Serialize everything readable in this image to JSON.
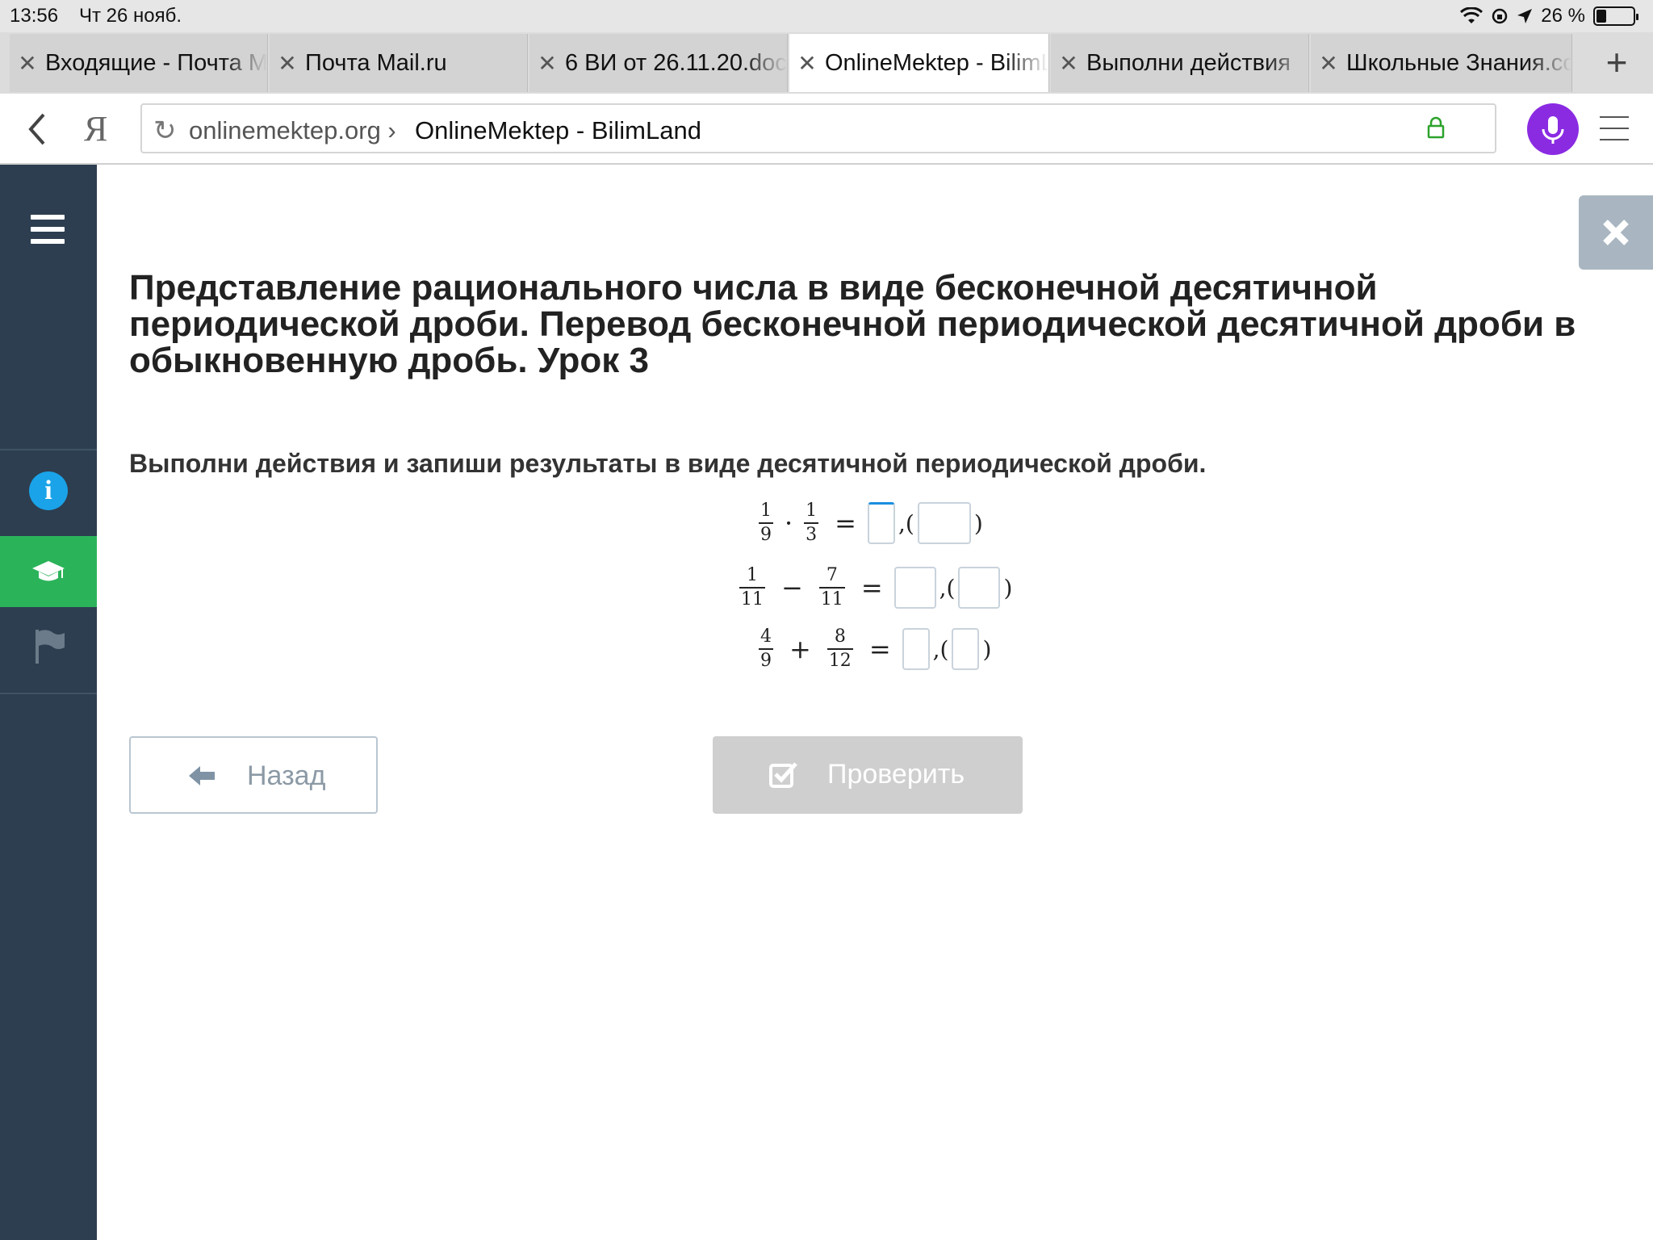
{
  "status_bar": {
    "time": "13:56",
    "date": "Чт 26 нояб.",
    "battery_text": "26 %",
    "battery_level": 0.26
  },
  "tabs": [
    {
      "label": "Входящие - Почта Mail.ru"
    },
    {
      "label": "Почта Mail.ru"
    },
    {
      "label": "6 ВИ от 26.11.20.docx"
    },
    {
      "label": "OnlineMektep - BilimLand"
    },
    {
      "label": "Выполни действия"
    },
    {
      "label": "Школьные Знания.com"
    }
  ],
  "address_bar": {
    "yandex_letter": "Я",
    "domain": "onlinemektep.org ›",
    "page_title": "OnlineMektep - BilimLand"
  },
  "lesson": {
    "title": "Представление рационального числа в виде бесконечной десятичной периодической дроби. Перевод бесконечной периодической десятичной дроби в обыкновенную дробь. Урок 3",
    "task": "Выполни действия и запиши результаты в виде десятичной периодической дроби."
  },
  "equations": [
    {
      "a_num": "1",
      "a_den": "9",
      "op": "·",
      "b_num": "1",
      "b_den": "3",
      "eq": "=",
      "comma": ",(",
      "close": ")"
    },
    {
      "a_num": "1",
      "a_den": "11",
      "op": "−",
      "b_num": "7",
      "b_den": "11",
      "eq": "=",
      "comma": ",(",
      "close": ")"
    },
    {
      "a_num": "4",
      "a_den": "9",
      "op": "+",
      "b_num": "8",
      "b_den": "12",
      "eq": "=",
      "comma": ",(",
      "close": ")"
    }
  ],
  "buttons": {
    "back": "Назад",
    "check": "Проверить"
  },
  "colors": {
    "sidebar": "#2d3e50",
    "sidebar_active": "#2bb35a",
    "info_icon": "#1aa3e8",
    "mic_button": "#8a2be2",
    "close_panel": "#a9b6c1",
    "check_button": "#cfcfcf"
  }
}
